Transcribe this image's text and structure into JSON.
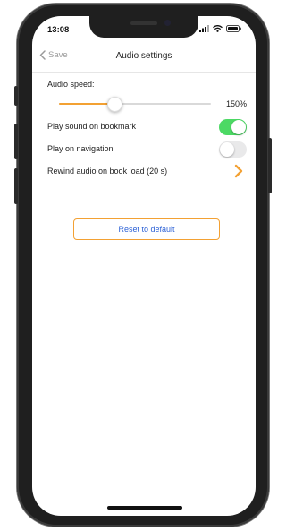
{
  "status_bar": {
    "time": "13:08"
  },
  "navbar": {
    "back_label": "Save",
    "title": "Audio settings"
  },
  "settings": {
    "audio_speed_label": "Audio speed:",
    "audio_speed_value": "150%",
    "audio_speed_fraction": 0.36,
    "play_sound_on_bookmark_label": "Play sound on bookmark",
    "play_sound_on_bookmark_on": true,
    "play_on_navigation_label": "Play on navigation",
    "play_on_navigation_on": false,
    "rewind_label": "Rewind audio on book load (20 s)"
  },
  "reset_button": {
    "label": "Reset to default"
  },
  "colors": {
    "accent": "#f3a133",
    "toggle_on": "#4cd964",
    "link_blue": "#2f63d6"
  }
}
